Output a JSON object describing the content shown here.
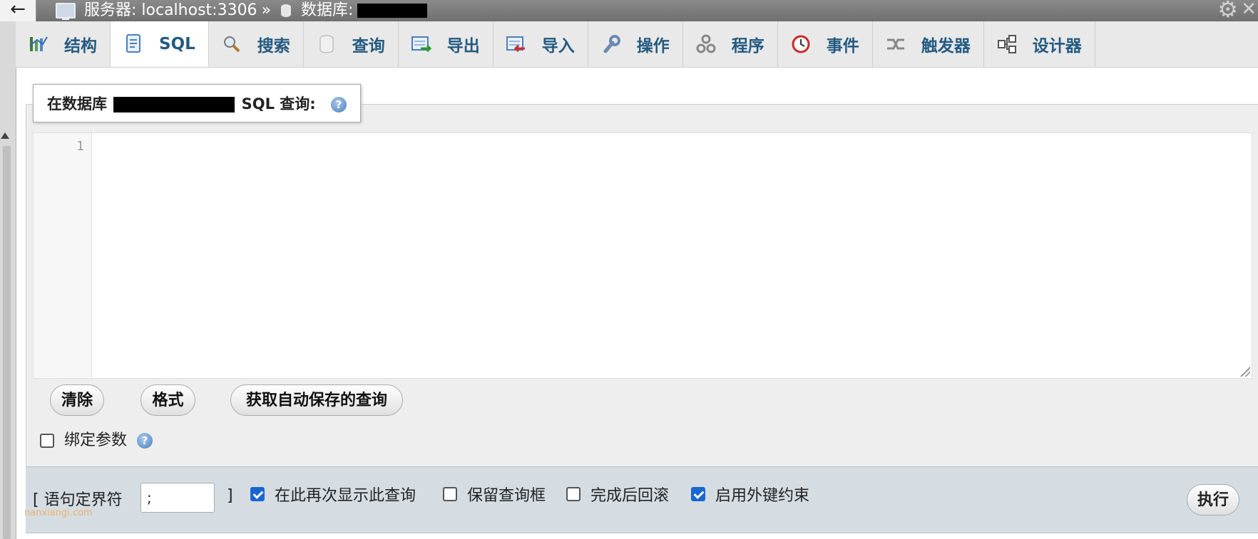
{
  "topbar": {
    "back_label": "←",
    "server_crumb": "服务器: localhost:3306",
    "separator": "»",
    "database_crumb": "数据库:"
  },
  "tabs": [
    {
      "label": "结构",
      "icon": "structure-icon"
    },
    {
      "label": "SQL",
      "icon": "sql-icon"
    },
    {
      "label": "搜索",
      "icon": "search-icon"
    },
    {
      "label": "查询",
      "icon": "query-icon"
    },
    {
      "label": "导出",
      "icon": "export-icon"
    },
    {
      "label": "导入",
      "icon": "import-icon"
    },
    {
      "label": "操作",
      "icon": "wrench-icon"
    },
    {
      "label": "程序",
      "icon": "routines-icon"
    },
    {
      "label": "事件",
      "icon": "clock-icon"
    },
    {
      "label": "触发器",
      "icon": "triggers-icon"
    },
    {
      "label": "设计器",
      "icon": "designer-icon"
    }
  ],
  "active_tab": "SQL",
  "query_box": {
    "legend_prefix": "在数据库",
    "legend_suffix": "SQL 查询:",
    "help": "?",
    "line_number": "1",
    "value": ""
  },
  "buttons": {
    "clear": "清除",
    "format": "格式",
    "autosave": "获取自动保存的查询"
  },
  "bind_params": {
    "label": "绑定参数",
    "checked": false
  },
  "footer": {
    "delimiter_open": "[ 语句定界符",
    "delimiter_value": ";",
    "delimiter_close": "]",
    "options": [
      {
        "label": "在此再次显示此查询",
        "checked": true
      },
      {
        "label": "保留查询框",
        "checked": false
      },
      {
        "label": "完成后回滚",
        "checked": false
      },
      {
        "label": "启用外键约束",
        "checked": true
      }
    ],
    "go": "执行"
  },
  "watermark": "nanxiangi.com",
  "colors": {
    "tab_text": "#235a81",
    "checkbox_checked": "#1a66d2",
    "footer_bg": "#d5dde3"
  }
}
